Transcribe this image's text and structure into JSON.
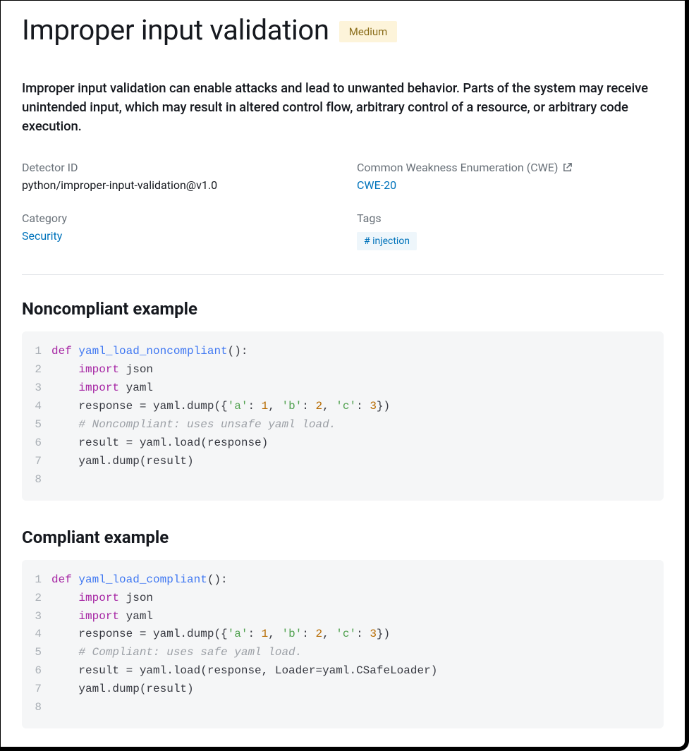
{
  "header": {
    "title": "Improper input validation",
    "severity": "Medium"
  },
  "description": "Improper input validation can enable attacks and lead to unwanted behavior. Parts of the system may receive unintended input, which may result in altered control flow, arbitrary control of a resource, or arbitrary code execution.",
  "meta": {
    "detector_id_label": "Detector ID",
    "detector_id_value": "python/improper-input-validation@v1.0",
    "cwe_label": "Common Weakness Enumeration (CWE)",
    "cwe_link_text": "CWE-20",
    "category_label": "Category",
    "category_link_text": "Security",
    "tags_label": "Tags",
    "tag_value": "# injection"
  },
  "sections": {
    "noncompliant_title": "Noncompliant example",
    "compliant_title": "Compliant example"
  },
  "code": {
    "noncompliant": [
      {
        "n": "1",
        "tokens": [
          [
            "kw",
            "def "
          ],
          [
            "fn",
            "yaml_load_noncompliant"
          ],
          [
            "pn",
            "():"
          ]
        ]
      },
      {
        "n": "2",
        "tokens": [
          [
            "pn",
            "    "
          ],
          [
            "kw",
            "import"
          ],
          [
            "pn",
            " json"
          ]
        ]
      },
      {
        "n": "3",
        "tokens": [
          [
            "pn",
            "    "
          ],
          [
            "kw",
            "import"
          ],
          [
            "pn",
            " yaml"
          ]
        ]
      },
      {
        "n": "4",
        "tokens": [
          [
            "pn",
            "    response = yaml.dump({"
          ],
          [
            "str",
            "'a'"
          ],
          [
            "pn",
            ": "
          ],
          [
            "num",
            "1"
          ],
          [
            "pn",
            ", "
          ],
          [
            "str",
            "'b'"
          ],
          [
            "pn",
            ": "
          ],
          [
            "num",
            "2"
          ],
          [
            "pn",
            ", "
          ],
          [
            "str",
            "'c'"
          ],
          [
            "pn",
            ": "
          ],
          [
            "num",
            "3"
          ],
          [
            "pn",
            "})"
          ]
        ]
      },
      {
        "n": "5",
        "tokens": [
          [
            "pn",
            "    "
          ],
          [
            "cm",
            "# Noncompliant: uses unsafe yaml load."
          ]
        ]
      },
      {
        "n": "6",
        "tokens": [
          [
            "pn",
            "    result = yaml.load(response)"
          ]
        ]
      },
      {
        "n": "7",
        "tokens": [
          [
            "pn",
            "    yaml.dump(result)"
          ]
        ]
      },
      {
        "n": "8",
        "tokens": [
          [
            "pn",
            ""
          ]
        ]
      }
    ],
    "compliant": [
      {
        "n": "1",
        "tokens": [
          [
            "kw",
            "def "
          ],
          [
            "fn",
            "yaml_load_compliant"
          ],
          [
            "pn",
            "():"
          ]
        ]
      },
      {
        "n": "2",
        "tokens": [
          [
            "pn",
            "    "
          ],
          [
            "kw",
            "import"
          ],
          [
            "pn",
            " json"
          ]
        ]
      },
      {
        "n": "3",
        "tokens": [
          [
            "pn",
            "    "
          ],
          [
            "kw",
            "import"
          ],
          [
            "pn",
            " yaml"
          ]
        ]
      },
      {
        "n": "4",
        "tokens": [
          [
            "pn",
            "    response = yaml.dump({"
          ],
          [
            "str",
            "'a'"
          ],
          [
            "pn",
            ": "
          ],
          [
            "num",
            "1"
          ],
          [
            "pn",
            ", "
          ],
          [
            "str",
            "'b'"
          ],
          [
            "pn",
            ": "
          ],
          [
            "num",
            "2"
          ],
          [
            "pn",
            ", "
          ],
          [
            "str",
            "'c'"
          ],
          [
            "pn",
            ": "
          ],
          [
            "num",
            "3"
          ],
          [
            "pn",
            "})"
          ]
        ]
      },
      {
        "n": "5",
        "tokens": [
          [
            "pn",
            "    "
          ],
          [
            "cm",
            "# Compliant: uses safe yaml load."
          ]
        ]
      },
      {
        "n": "6",
        "tokens": [
          [
            "pn",
            "    result = yaml.load(response, Loader=yaml.CSafeLoader)"
          ]
        ]
      },
      {
        "n": "7",
        "tokens": [
          [
            "pn",
            "    yaml.dump(result)"
          ]
        ]
      },
      {
        "n": "8",
        "tokens": [
          [
            "pn",
            ""
          ]
        ]
      }
    ]
  }
}
